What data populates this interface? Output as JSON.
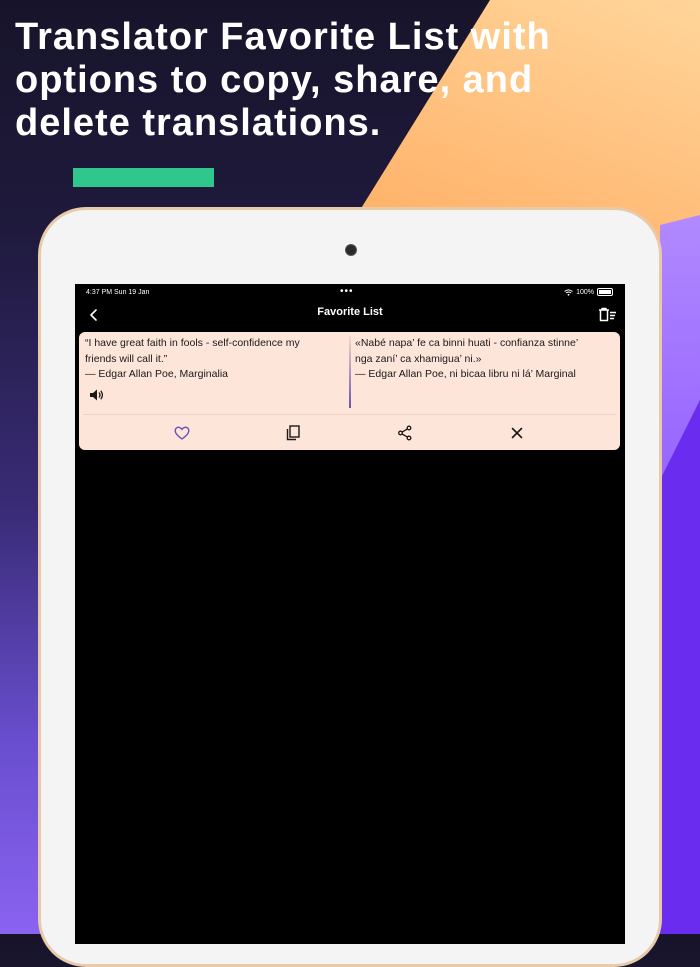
{
  "headline": {
    "line1": "Translator Favorite List with",
    "line2": "options to copy, share, and",
    "line3": "delete translations."
  },
  "colors": {
    "accent_green": "#2fc78c",
    "card_bg": "#fde5d9",
    "heart_purple": "#6a52b8"
  },
  "status_bar": {
    "time_date": "4:37 PM  Sun 19 Jan",
    "battery": "100%"
  },
  "nav": {
    "title": "Favorite List",
    "back_icon": "chevron-left-icon",
    "delete_all_icon": "trash-list-icon"
  },
  "favorites": [
    {
      "source_line1": "“I have great faith in fools - self-confidence my",
      "source_line2": "friends will call it.”",
      "source_line3": "— Edgar Allan Poe, Marginalia",
      "target_line1": "«Nabé napa’ fe ca binni huati - confianza stinne’",
      "target_line2": "nga zaní’ ca xhamigua’ ni.»",
      "target_line3": "— Edgar Allan Poe, ni bicaa libru ni lá’ Marginal",
      "actions": [
        "heart-icon",
        "copy-icon",
        "share-icon",
        "close-icon"
      ]
    }
  ]
}
